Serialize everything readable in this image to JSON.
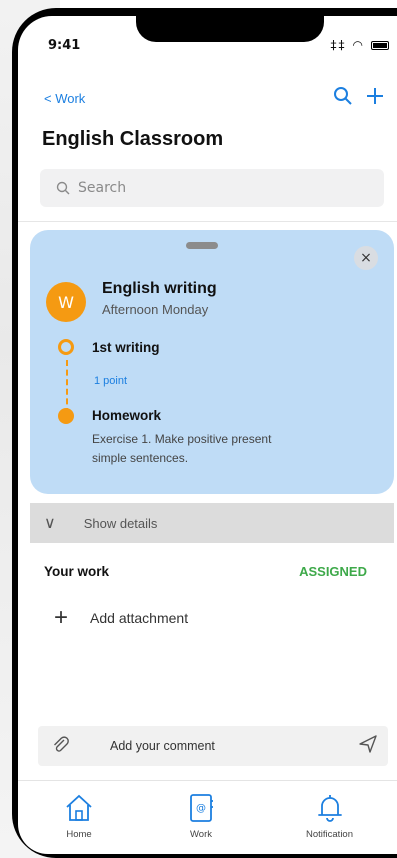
{
  "status_bar": {
    "time": "9:41",
    "signal": "‡‡",
    "wifi": "◠"
  },
  "header": {
    "back_label": "< Work",
    "title": "English Classroom",
    "search_icon": "search-icon",
    "add_icon": "plus-icon"
  },
  "search": {
    "placeholder": "Search"
  },
  "assignment": {
    "avatar_letter": "W",
    "class_name": "English writing",
    "schedule": "Afternoon Monday",
    "close": "×",
    "timeline": [
      {
        "title": "1st writing",
        "detail": "1 point"
      },
      {
        "title": "Homework",
        "detail": "Exercise 1. Make positive present simple sentences."
      }
    ]
  },
  "details": {
    "chevron": "∨",
    "label": "Show details"
  },
  "your_work": {
    "label": "Your work",
    "status": "ASSIGNED",
    "status_color": "#3ea94a",
    "attach_plus": "+",
    "attach_label": "Add attachment"
  },
  "comment": {
    "placeholder": "Add your comment",
    "clip_icon": "paperclip-icon",
    "send_icon": "send-icon"
  },
  "tabs": [
    {
      "label": "Home",
      "icon": "home-icon"
    },
    {
      "label": "Work",
      "icon": "work-icon"
    },
    {
      "label": "Notification",
      "icon": "bell-icon"
    }
  ],
  "colors": {
    "accent": "#1c7fe0",
    "card_bg": "#bfdcf6",
    "timeline": "#f59a12",
    "avatar": "#f59a12"
  }
}
